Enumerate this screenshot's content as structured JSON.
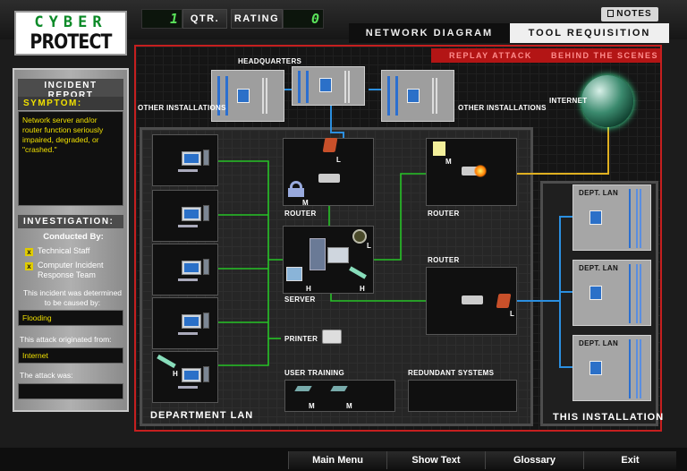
{
  "logo": {
    "line1": "CYBER",
    "line2": "PROTECT"
  },
  "header": {
    "qtr_value": "1",
    "qtr_label": "QTR.",
    "rating_label": "RATING",
    "rating_value": "0",
    "notes_label": "NOTES"
  },
  "tabs": {
    "network_diagram": "NETWORK DIAGRAM",
    "tool_requisition": "TOOL REQUISITION"
  },
  "subtabs": {
    "replay_attack": "REPLAY ATTACK",
    "behind_the_scenes": "BEHIND THE SCENES"
  },
  "incident": {
    "title": "INCIDENT REPORT",
    "symptom_heading": "SYMPTOM:",
    "symptom_text": "Network server and/or router function seriously impaired, degraded, or \"crashed.\"",
    "investigation_heading": "INVESTIGATION:",
    "conducted_by_label": "Conducted By:",
    "investigators": [
      "Technical Staff",
      "Computer Incident Response Team"
    ],
    "cause_label": "This incident was determined to be caused by:",
    "cause_value": "Flooding",
    "origin_label": "This attack originated from:",
    "origin_value": "Internet",
    "attack_label": "The attack was:",
    "attack_value": ""
  },
  "diagram": {
    "headquarters": "HEADQUARTERS",
    "other_installations_left": "OTHER INSTALLATIONS",
    "other_installations_right": "OTHER INSTALLATIONS",
    "internet": "INTERNET",
    "router_left": "ROUTER",
    "router_right": "ROUTER",
    "router_bottom": "ROUTER",
    "server": "SERVER",
    "printer": "PRINTER",
    "user_training": "USER TRAINING",
    "redundant_systems": "REDUNDANT SYSTEMS",
    "department_lan": "DEPARTMENT LAN",
    "this_installation": "THIS INSTALLATION",
    "dept_lan": [
      "DEPT. LAN",
      "DEPT. LAN",
      "DEPT. LAN"
    ],
    "tool_marks": {
      "router_l_top": "L",
      "router_l_bottom": "L",
      "lock_m": "M",
      "server_l": "L",
      "server_h": "H",
      "server_h2": "H",
      "note_m": "M",
      "pc_h": "H",
      "training_m1": "M",
      "training_m2": "M"
    }
  },
  "colors": {
    "accent_red": "#c51f1f",
    "link_green": "#27c427",
    "link_blue": "#2b8fe0",
    "link_yellow": "#e0b020"
  },
  "bottom_menu": [
    "Main Menu",
    "Show Text",
    "Glossary",
    "Exit"
  ]
}
